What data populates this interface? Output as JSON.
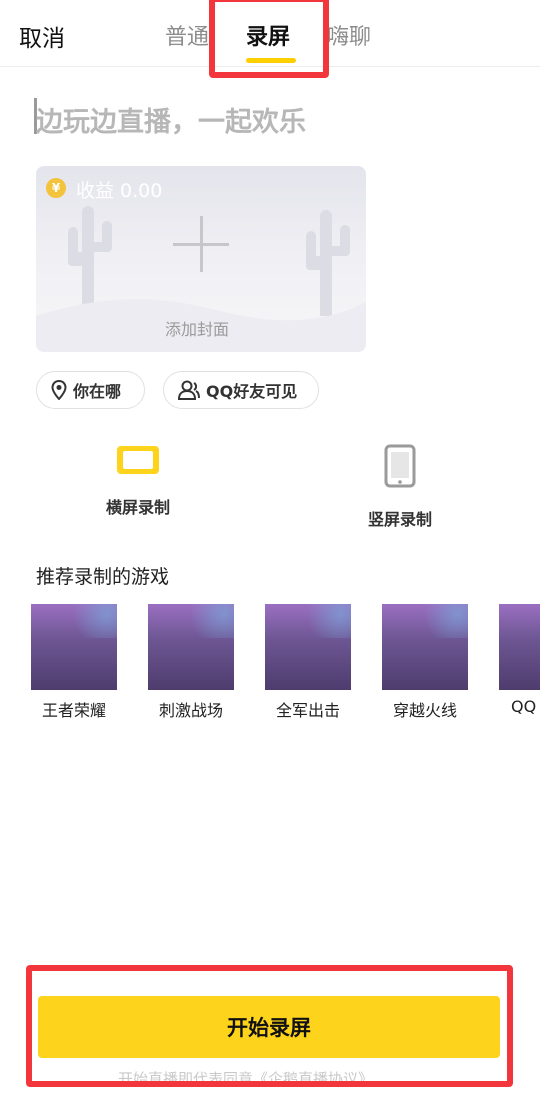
{
  "header": {
    "cancel_label": "取消",
    "tabs": [
      {
        "label": "普通",
        "active": false
      },
      {
        "label": "录屏",
        "active": true
      },
      {
        "label": "嗨聊",
        "active": false
      }
    ]
  },
  "title_input": {
    "placeholder": "边玩边直播，一起欢乐"
  },
  "cover": {
    "income_label": "收益 0.00",
    "coin_symbol": "¥",
    "add_cover_label": "添加封面"
  },
  "chips": {
    "location_label": "你在哪",
    "visibility_label": "QQ好友可见"
  },
  "orientation": {
    "landscape_label": "横屏录制",
    "portrait_label": "竖屏录制"
  },
  "recommended": {
    "title": "推荐录制的游戏",
    "games": [
      "王者荣耀",
      "刺激战场",
      "全军出击",
      "穿越火线",
      "QQ"
    ]
  },
  "footer": {
    "start_label": "开始录屏",
    "agreement_text": "开始直播即代表同意《企鹅直播协议》"
  },
  "colors": {
    "accent_yellow": "#fed31b",
    "highlight_red": "#f2363b"
  },
  "icons": [
    "location-pin-icon",
    "user-icon",
    "landscape-screen-icon",
    "portrait-phone-icon",
    "coin-icon",
    "plus-icon"
  ]
}
